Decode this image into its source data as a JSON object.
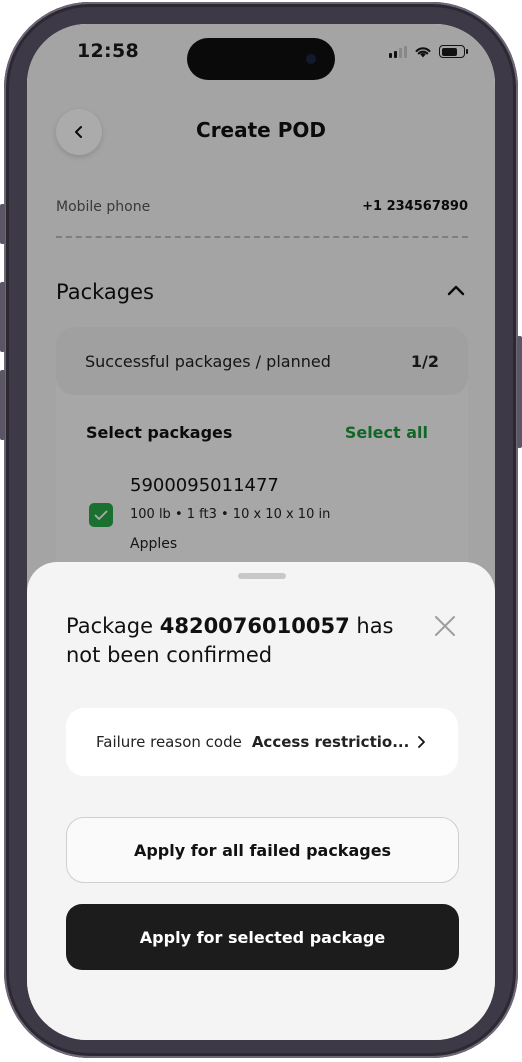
{
  "status_bar": {
    "time": "12:58"
  },
  "header": {
    "title": "Create POD"
  },
  "contact": {
    "label": "Mobile phone",
    "value": "+1 234567890"
  },
  "packages": {
    "title": "Packages",
    "summary_label": "Successful packages / planned",
    "summary_count": "1/2",
    "select_label": "Select packages",
    "select_all_label": "Select all",
    "items": [
      {
        "code": "5900095011477",
        "spec": "100 lb • 1 ft3 • 10 x 10 x 10 in",
        "name": "Apples",
        "checked": true
      }
    ]
  },
  "sheet": {
    "title_prefix": "Package ",
    "package_code": "4820076010057",
    "title_suffix": " has not been confirmed",
    "reason_label": "Failure reason code",
    "reason_value": "Access restrictio...",
    "apply_all_label": "Apply for all failed packages",
    "apply_selected_label": "Apply for selected package"
  },
  "colors": {
    "accent_green": "#1c9a3a",
    "checkbox_green": "#27a745",
    "primary_button": "#1c1c1c",
    "frame": "#3d3946"
  }
}
